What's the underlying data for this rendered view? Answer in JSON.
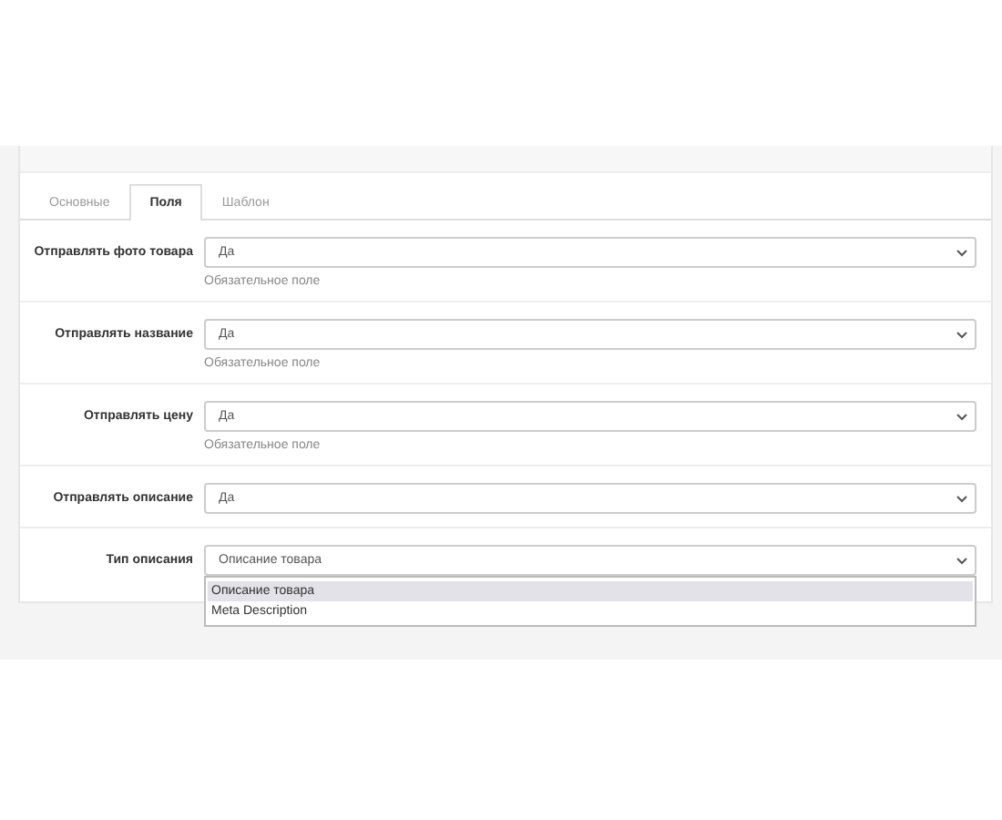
{
  "tabs": [
    {
      "label": "Основные",
      "selected": false
    },
    {
      "label": "Поля",
      "selected": true
    },
    {
      "label": "Шаблон",
      "selected": false
    }
  ],
  "fields": [
    {
      "label": "Отправлять фото товара",
      "value": "Да",
      "help": "Обязательное поле"
    },
    {
      "label": "Отправлять название",
      "value": "Да",
      "help": "Обязательное поле"
    },
    {
      "label": "Отправлять цену",
      "value": "Да",
      "help": "Обязательное поле"
    },
    {
      "label": "Отправлять описание",
      "value": "Да"
    },
    {
      "label": "Тип описания",
      "value": "Описание товара",
      "expanded": true,
      "options": [
        {
          "label": "Описание товара",
          "selected": true
        },
        {
          "label": "Meta Description",
          "selected": false
        }
      ]
    }
  ]
}
